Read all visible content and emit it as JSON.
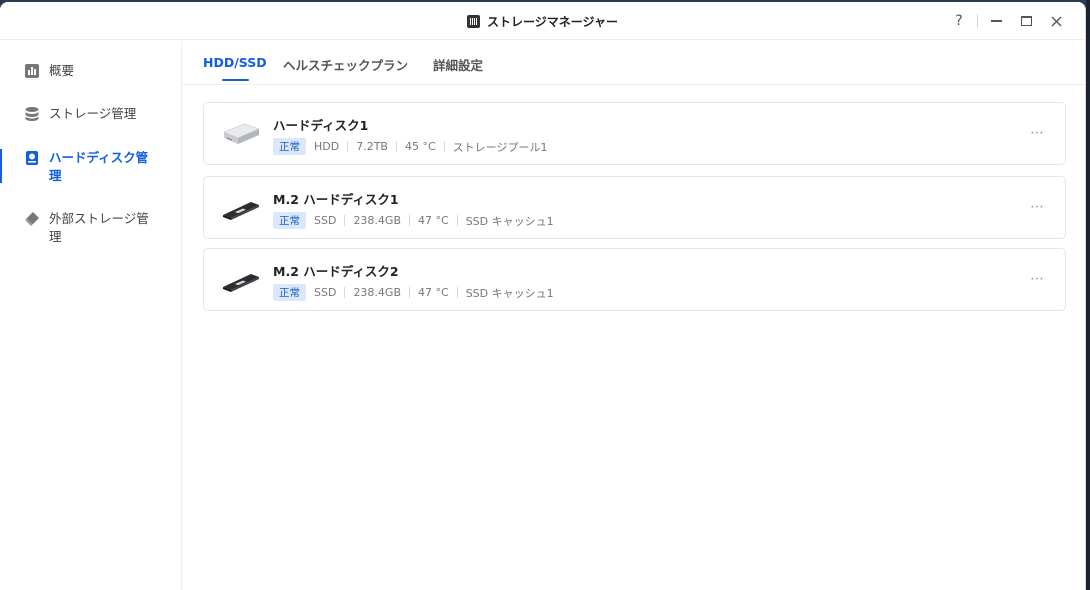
{
  "window": {
    "title": "ストレージマネージャー",
    "help": "?"
  },
  "sidebar": {
    "items": [
      {
        "label": "概要",
        "icon": "overview-chart-icon",
        "active": false
      },
      {
        "label": "ストレージ管理",
        "icon": "database-icon",
        "active": false
      },
      {
        "label": "ハードディスク管理",
        "icon": "hard-disk-icon",
        "active": true
      },
      {
        "label": "外部ストレージ管理",
        "icon": "usb-drive-icon",
        "active": false
      }
    ]
  },
  "tabs": [
    {
      "label": "HDD/SSD",
      "active": true
    },
    {
      "label": "ヘルスチェックプラン",
      "active": false
    },
    {
      "label": "詳細設定",
      "active": false
    }
  ],
  "disks": [
    {
      "name": "ハードディスク1",
      "status": "正常",
      "type": "HDD",
      "capacity": "7.2TB",
      "temp": "45 °C",
      "usage": "ストレージプール1",
      "icon": "hdd-icon"
    },
    {
      "name": "M.2 ハードディスク1",
      "status": "正常",
      "type": "SSD",
      "capacity": "238.4GB",
      "temp": "47 °C",
      "usage": "SSD キャッシュ1",
      "icon": "m2-ssd-icon"
    },
    {
      "name": "M.2 ハードディスク2",
      "status": "正常",
      "type": "SSD",
      "capacity": "238.4GB",
      "temp": "47 °C",
      "usage": "SSD キャッシュ1",
      "icon": "m2-ssd-icon"
    }
  ],
  "colors": {
    "accent": "#1060e0",
    "badge_bg": "#dbe8fb",
    "badge_text": "#1a5fc8"
  }
}
